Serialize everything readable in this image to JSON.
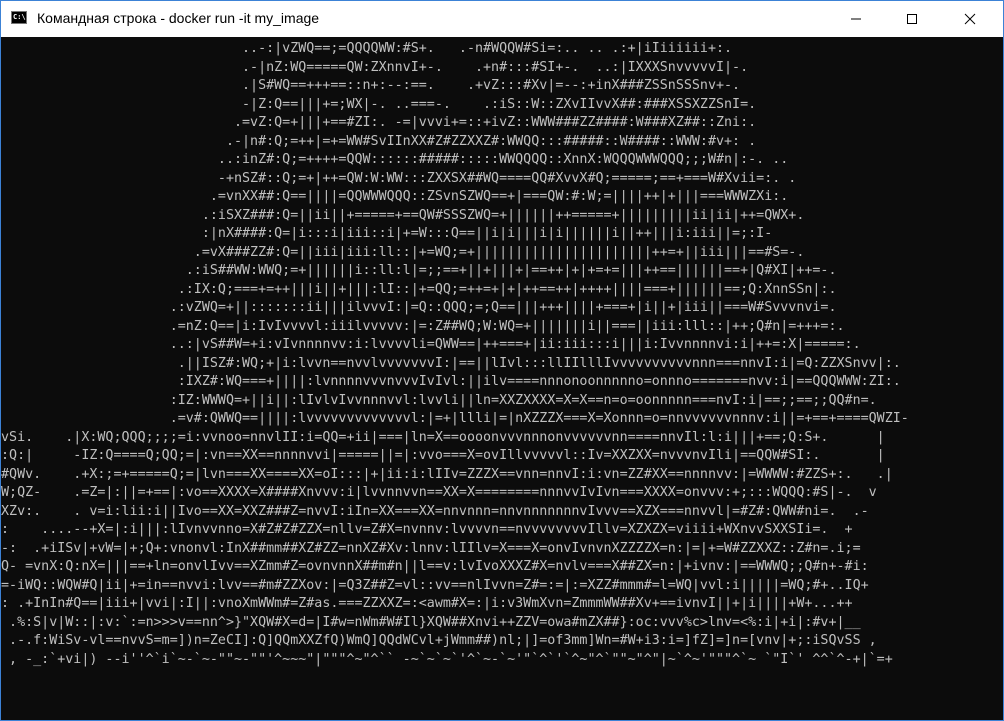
{
  "window": {
    "title": "Командная строка - docker  run -it my_image",
    "icon_text": "C:\\",
    "controls": [
      "minimize-icon",
      "maximize-icon",
      "close-icon"
    ]
  },
  "colors": {
    "console_bg": "#0c0c0c",
    "console_fg": "#c0c0c0",
    "titlebar_bg": "#ffffff"
  },
  "console": {
    "lines": [
      "                              ..-:|vZWQ==;=QQQQWW:#S+.   .-n#WQQW#Si=:.. .. .:+|iIiiiiii+:.",
      "                              .-|nZ:WQ=====QW:ZXnnvI+-.    .+n#:::#SI+-.  ..:|IXXXSnvvvvvI|-.",
      "                              .|S#WQ==+++==::n+:--:==.    .+vZ:::#Xv|=--:+inX###ZSSnSSSnv+-.",
      "                              -|Z:Q==|||+=;WX|-. ..===-.    .:iS::W::ZXvIIvvX##:###XSSXZZSnI=.",
      "                             .=vZ:Q=+|||+==#ZI:. -=|vvvi+=::+ivZ::WWW###ZZ####:W###XZ##::Zni:.",
      "                            .-|n#:Q;=++|=+=WW#SvIInXX#Z#ZZXXZ#:WWQQ:::#####::W####::WWW:#v+: .",
      "                           ..:inZ#:Q;=++++=QQW::::::#####:::::WWQQQQ::XnnX:WQQQWWWQQQ;;;W#n|:-. ..",
      "                           -+nSZ#::Q;=+|++=QW:W:WW:::ZXXSX##WQ====QQ#XvvX#Q;=====;==+===W#Xvii=:. .",
      "                          .=vnXX##:Q==||||=QQWWWQQQ::ZSvnSZWQ==+|===QW:#:W;=||||++|+|||===WWWZXi:.",
      "                         .:iSXZ###:Q=||ii||+=====+==QW#SSSZWQ=+||||||++=====+|||||||||ii|ii|++=QWX+.",
      "                         :|nX####:Q=|i:::i|iii::i|+=W:::Q==||i|i|||i|i||||||i||++|||i:iii||=;:I-",
      "                        .=vX###ZZ#:Q=||iii|iii:ll::|+=WQ;=+||||||||||||||||||||||++=+||iii|||==#S=-.",
      "                       .:iS##WW:WWQ;=+||||||i::ll:l|=;;==+||+|||+|==++|+|+=+=|||++==||||||==+|Q#XI|++=-.",
      "                      .:IX:Q;===+=++|||i||+|||:lI::|+=QQ;=++=+|+|++==++|++++||||===+||||||==;Q:XnnSSn|:.",
      "                     .:vZWQ=+||:::::::ii|||ilvvvI:|=Q::QQQ;=;Q==|||+++||||+===+|i||+|iii||===W#Svvvnvi=.",
      "                     .=nZ:Q==|i:IvIvvvvl:iiilvvvvv:|=:Z##WQ;W:WQ=+|||||||i||===||iii:lll::|++;Q#n|=+++=:.",
      "                     ..:|vS##W=+i:vIvnnnnvv:i:lvvvvli=QWW==|++===+|ii:iii:::i|||i:Ivvnnnnvi:i|++=:X|=====:.",
      "                      .||ISZ#:WQ;+|i:lvvn==nvvlvvvvvvvI:|==||lIvl:::llIIlllIvvvvvvvvvvnnn===nnvI:i|=Q:ZZXSnvv|:.",
      "                      :IXZ#:WQ===+||||:lvnnnnvvvnvvvIvIvl:||ilv====nnnonoonnnnno=onnno=======nvv:i|==QQQWWW:ZI:.",
      "                     :IZ:WWWQ=+||i||:lIvlvIvvnnnvvl:lvvli||ln=XXZXXXX=X=X==n=o=oonnnnn===nvI:i|==;;==;;QQ#n=.",
      "                     .=v#:QWWQ==||||:lvvvvvvvvvvvvvl:|=+|llli|=|nXZZZX===X=Xonnn=o=nnvvvvvvnnnv:i||=+==+====QWZI-",
      "vSi.    .|X:WQ;QQQ;;;;=i:vvnoo=nnvlII:i=QQ=+ii|===|ln=X==oooonvvvnnnonvvvvvvnn====nnvIl:l:i|||+==;Q:S+.      |",
      ":Q:|     -IZ:Q====Q;QQ;=|:vn==XX==nnnnvvi|=====||=|:vvo===X=ovIllvvvvvl::Iv=XXZXX=nvvvnvIli|==QQW#SI:.       |",
      "#QWv.    .+X:;=+=====Q;=|lvn===XX====XX=oI:::|+|ii:i:lIIv=ZZZX==vnn=nnvI:i:vn=ZZ#XX==nnnnvv:|=WWWW:#ZZS+:.   .|",
      "W;QZ-    .=Z=|:||=+==|:vo==XXXX=X####Xnvvv:i|lvvnnvvn==XX=X========nnnvvIvIvn===XXXX=onvvv:+;:::WQQQ:#S|-.  v",
      "XZv:.    . v=i:lii:i||Ivo==XX=XXZ###Z=nvvI:iIn=XX===XX=nnvnnn=nnvnnnnnnnvIvvv==XZX===nnvvl|=#Z#:QWW#ni=.  .-",
      ":    ....--+X=|:i|||:lIvnvvnno=X#Z#Z#ZZX=nllv=Z#X=nvnnv:lvvvvn==nvvvvvvvvIllv=XZXZX=viiii+WXnvvSXXSIi=.  +",
      "-:  .+iISv|+vW=|+;Q+:vnonvl:InX##mm##XZ#ZZ=nnXZ#Xv:lnnv:lIIlv=X===X=onvIvnvnXZZZZX=n:|=|+=W#ZZXXZ::Z#n=.i;=",
      "Q- =vnX:Q:nX=|||==+ln=onvlIvv==XZmm#Z=ovnvnnX##m#n||l==v:lvIvoXXXZ#X=nvlv===X##ZX=n:|+ivnv:|==WWWQ;;Q#n+-#i:",
      "=-iWQ::WQW#Q|ii|+=in==nvvi:lvv==#m#ZZXov:|=Q3Z##Z=vl::vv==nlIvvn=Z#=:=|:=XZZ#mmm#=l=WQ|vvl:i|||||=WQ;#+..IQ+",
      ": .+InIn#Q==|iii+|vvi|:I||:vnoXmWWm#=Z#as.===ZZXXZ=:<awm#X=:|i:v3WmXvn=ZmmmWW##Xv+==ivnvI||+|i||||+W+...++",
      " .%:S|v|W::|:v:`:=n>>>v==nn^>}\"XQW#X=d=|I#w=nWm#W#Il}XQW##Xnvi++ZZV=owa#mZX##}:oc:vvv%c>lnv=<%:i|+i|:#v+|__",
      " .-.f:WiSv-vl==nvvS=m=])n=ZeCI]:Q]QQmXXZfQ)WmQ]QQdWCvl+jWmm##)nl;|]=of3mm]Wn=#W+i3:i=]fZ]=]n=[vnv|+;:iSQvSS ,",
      " , -_:`+vi|) --i''^`i`~-`~-\"\"~-\"\"'^~~~\"|\"\"\"^~\"^`` -~`~`~`'^`~-`~'\"`^`'`^~\"^`\"\"~\"^\"|~`^~'\"\"\"^`~ `\"I`' ^^`^-+|`=+"
    ]
  }
}
